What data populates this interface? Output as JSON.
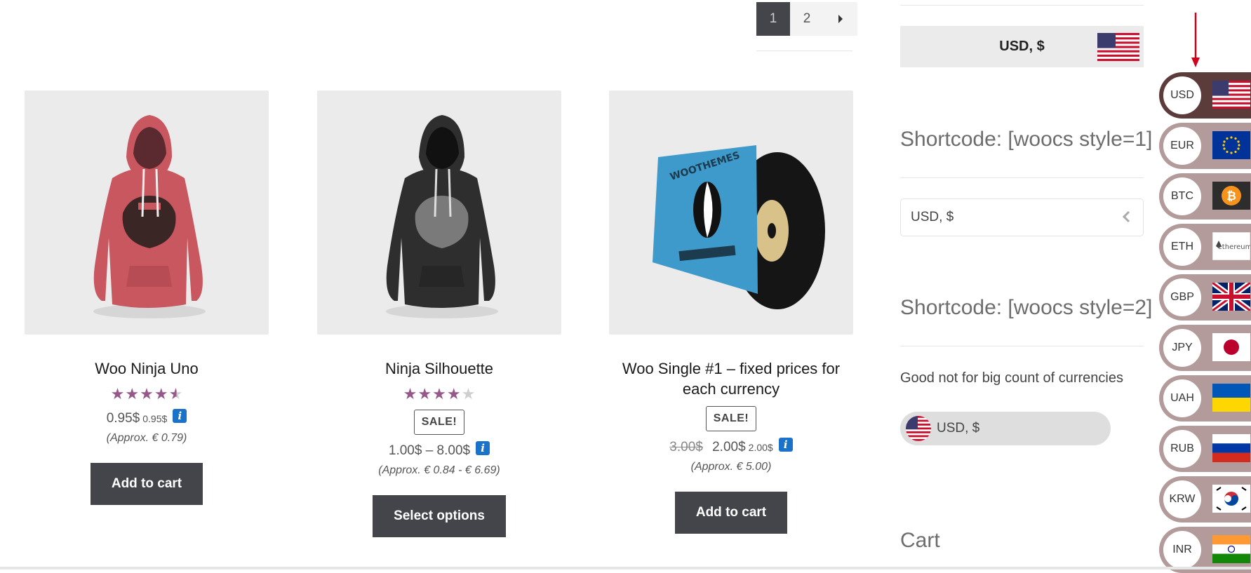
{
  "pagination": {
    "pages": [
      "1",
      "2"
    ],
    "current": "1",
    "next_icon": "caret-right-icon"
  },
  "products": [
    {
      "title": "Woo Ninja Uno",
      "rating": 4.5,
      "price": "0.95$",
      "price_small": "0.95$",
      "approx": "(Approx. € 0.79)",
      "button": "Add to cart",
      "image": "pink-hoodie"
    },
    {
      "title": "Ninja Silhouette",
      "rating": 4,
      "sale": "SALE!",
      "price": "1.00$ – 8.00$",
      "approx": "(Approx. € 0.84 - € 6.69)",
      "button": "Select options",
      "image": "black-hoodie"
    },
    {
      "title": "Woo Single #1 – fixed prices for each currency",
      "sale": "SALE!",
      "old_price": "3.00$",
      "price": "2.00$",
      "price_small": "2.00$",
      "approx": "(Approx. € 5.00)",
      "button": "Add to cart",
      "image": "vinyl-record",
      "album_text": "WOOTHEMES"
    }
  ],
  "info_icon_char": "i",
  "sidebar": {
    "currency_bar": "USD, $",
    "shortcode1": "Shortcode: [woocs style=1]",
    "select_value": "USD, $",
    "shortcode2": "Shortcode: [woocs style=2]",
    "note": "Good not for big count of currencies",
    "pill_value": "USD, $",
    "cart_heading": "Cart"
  },
  "side_switcher": [
    {
      "code": "USD",
      "flag": "us",
      "active": true
    },
    {
      "code": "EUR",
      "flag": "eu"
    },
    {
      "code": "BTC",
      "flag": "btc"
    },
    {
      "code": "ETH",
      "flag": "eth",
      "flag_text": "ethereum"
    },
    {
      "code": "GBP",
      "flag": "gb"
    },
    {
      "code": "JPY",
      "flag": "jp"
    },
    {
      "code": "UAH",
      "flag": "ua"
    },
    {
      "code": "RUB",
      "flag": "ru"
    },
    {
      "code": "KRW",
      "flag": "kr"
    },
    {
      "code": "INR",
      "flag": "in"
    }
  ],
  "colors": {
    "star": "#96588a",
    "button": "#43454b",
    "switcher_active": "#5c3b3b",
    "switcher": "#b39b9b",
    "info": "#1a72c9",
    "arrow": "#d0021b"
  }
}
